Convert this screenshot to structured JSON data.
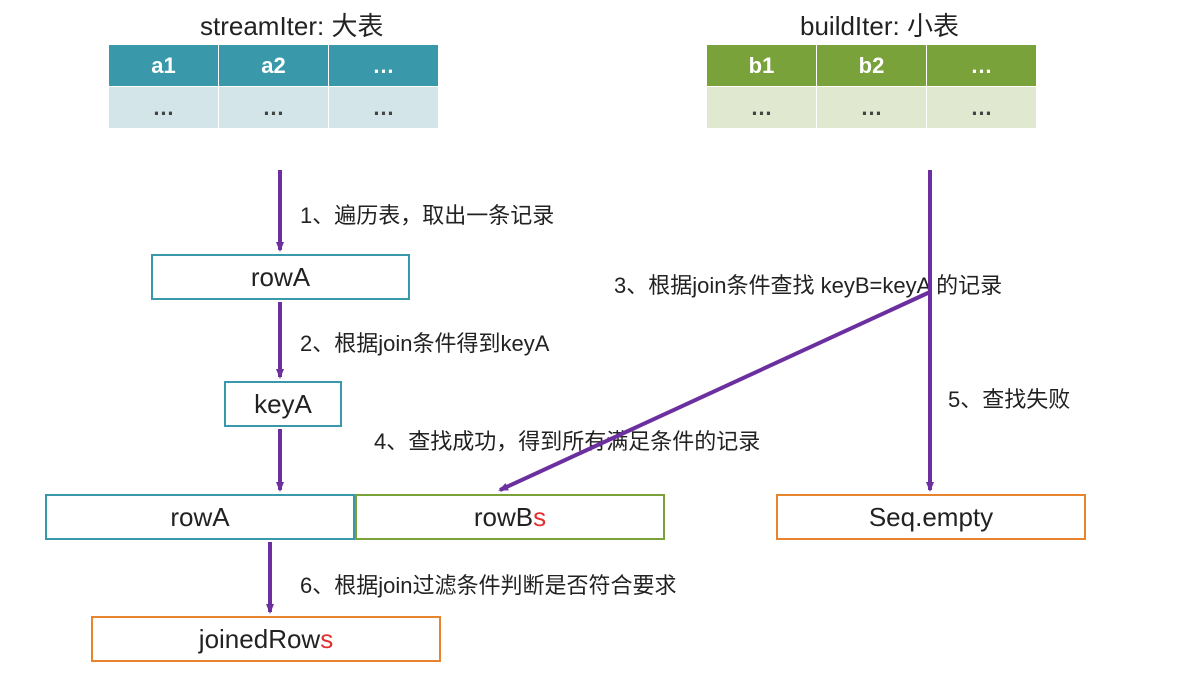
{
  "stream": {
    "title": "streamIter: 大表",
    "headers": [
      "a1",
      "a2",
      "…"
    ],
    "row": [
      "…",
      "…",
      "…"
    ]
  },
  "build": {
    "title": "buildIter: 小表",
    "headers": [
      "b1",
      "b2",
      "…"
    ],
    "row": [
      "…",
      "…",
      "…"
    ]
  },
  "boxes": {
    "rowA1": "rowA",
    "keyA": "keyA",
    "rowA2": "rowA",
    "rowBs_prefix": "rowB",
    "rowBs_suffix": "s",
    "seqEmpty": "Seq.empty",
    "joinedRows_prefix": "joinedRow",
    "joinedRows_suffix": "s"
  },
  "steps": {
    "s1": "1、遍历表，取出一条记录",
    "s2": "2、根据join条件得到keyA",
    "s3": "3、根据join条件查找 keyB=keyA 的记录",
    "s4": "4、查找成功，得到所有满足条件的记录",
    "s5": "5、查找失败",
    "s6": "6、根据join过滤条件判断是否符合要求"
  }
}
